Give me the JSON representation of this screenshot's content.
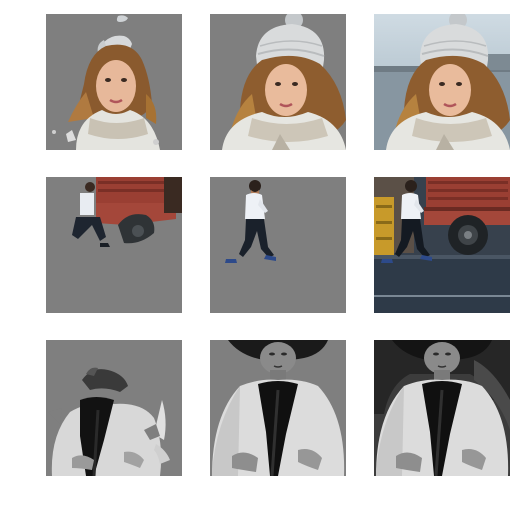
{
  "figure": {
    "rows": [
      {
        "subject": "woman-with-knit-hat",
        "tiles": [
          {
            "kind": "predicted-mask-composite"
          },
          {
            "kind": "refined-mask-composite"
          },
          {
            "kind": "original-photo"
          }
        ]
      },
      {
        "subject": "man-walking-by-truck",
        "tiles": [
          {
            "kind": "predicted-mask-composite"
          },
          {
            "kind": "refined-mask-composite"
          },
          {
            "kind": "original-photo"
          }
        ]
      },
      {
        "subject": "person-grayscale-portrait",
        "tiles": [
          {
            "kind": "predicted-mask-composite"
          },
          {
            "kind": "refined-mask-composite"
          },
          {
            "kind": "original-photo"
          }
        ]
      }
    ],
    "colors": {
      "mask_gray": "#7f7f7f",
      "background": "#ffffff"
    }
  }
}
